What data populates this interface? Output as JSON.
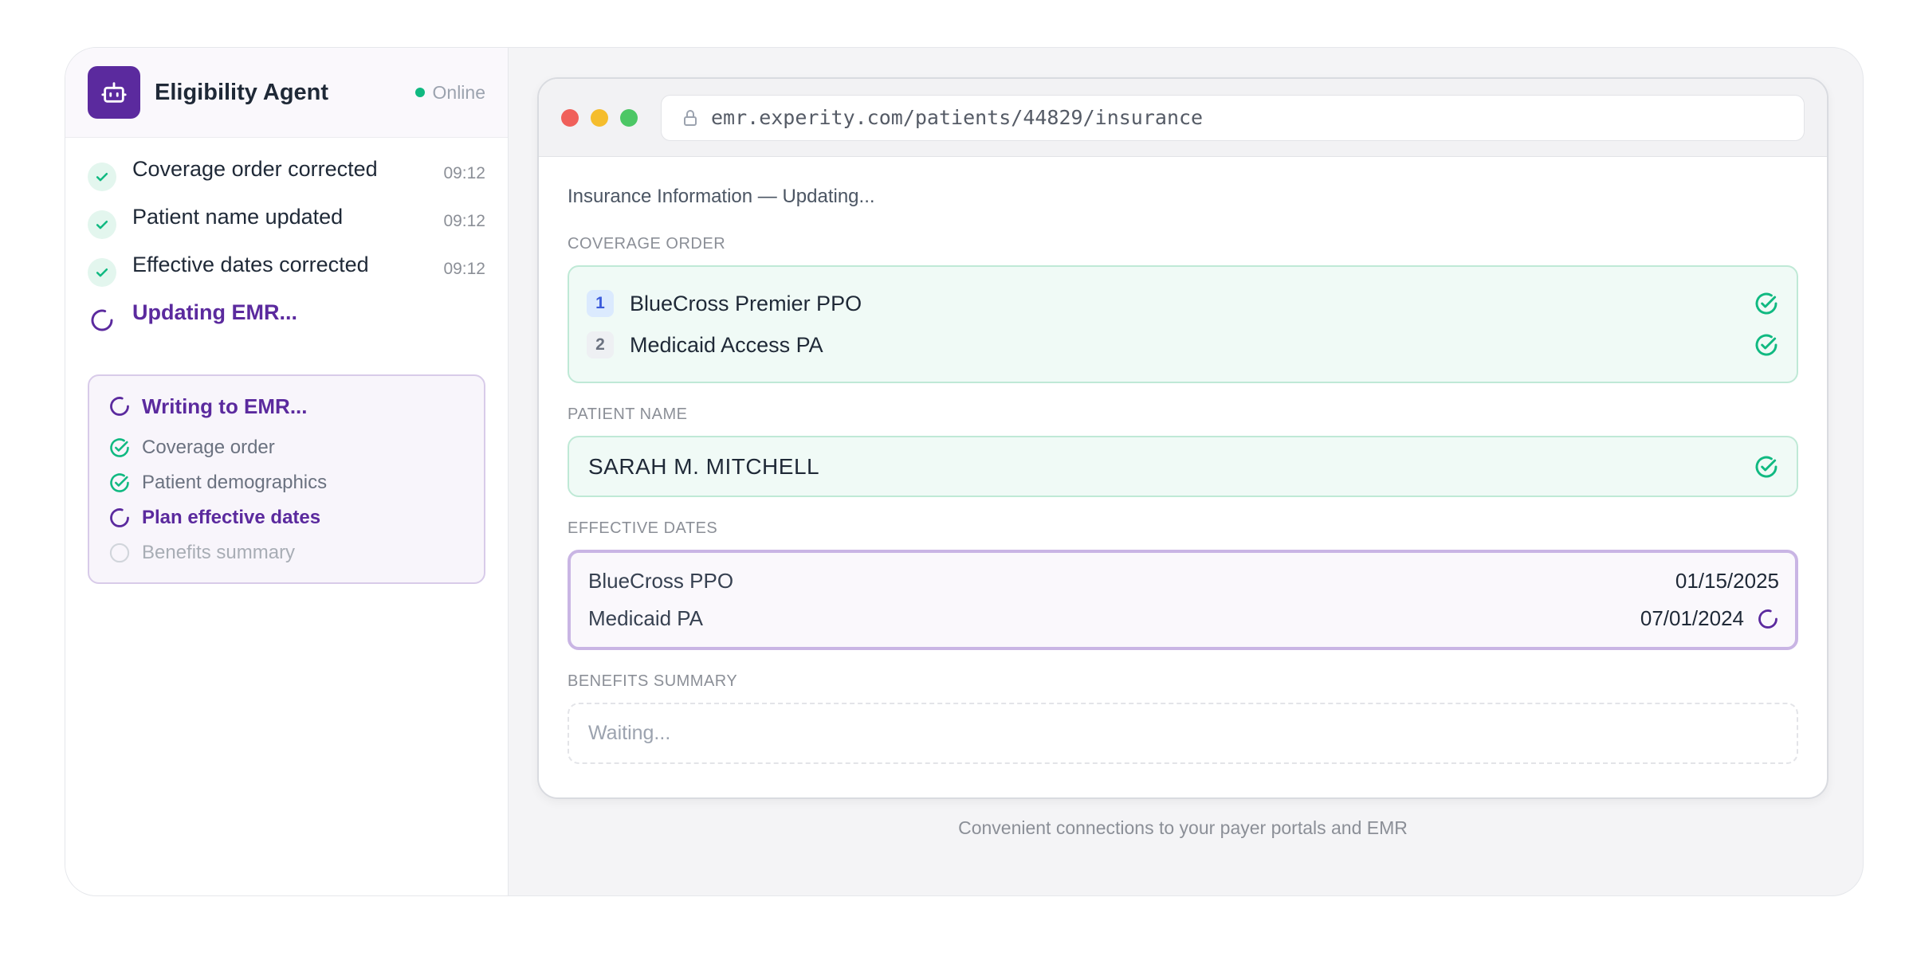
{
  "agent": {
    "title": "Eligibility Agent",
    "status": "Online",
    "status_color": "#10b981",
    "accent_color": "#5b2a9e",
    "steps": [
      {
        "label": "Coverage order corrected",
        "time": "09:12",
        "state": "done"
      },
      {
        "label": "Patient name updated",
        "time": "09:12",
        "state": "done"
      },
      {
        "label": "Effective dates corrected",
        "time": "09:12",
        "state": "done"
      },
      {
        "label": "Updating EMR...",
        "time": "",
        "state": "in-progress"
      }
    ],
    "emr_card": {
      "title": "Writing to EMR...",
      "items": [
        {
          "label": "Coverage order",
          "state": "done"
        },
        {
          "label": "Patient demographics",
          "state": "done"
        },
        {
          "label": "Plan effective dates",
          "state": "in-progress"
        },
        {
          "label": "Benefits summary",
          "state": "pending"
        }
      ]
    }
  },
  "browser": {
    "url": "emr.experity.com/patients/44829/insurance",
    "window_dots": [
      "#f0605a",
      "#f5bd2d",
      "#4cc765"
    ],
    "page_title": "Insurance Information — Updating...",
    "coverage_order": {
      "label": "COVERAGE ORDER",
      "items": [
        {
          "rank": "1",
          "name": "BlueCross Premier PPO",
          "verified": true
        },
        {
          "rank": "2",
          "name": "Medicaid Access PA",
          "verified": true
        }
      ]
    },
    "patient_name": {
      "label": "PATIENT NAME",
      "value": "SARAH M. MITCHELL",
      "verified": true
    },
    "effective_dates": {
      "label": "EFFECTIVE DATES",
      "rows": [
        {
          "plan": "BlueCross PPO",
          "date": "01/15/2025",
          "state": "done"
        },
        {
          "plan": "Medicaid PA",
          "date": "07/01/2024",
          "state": "in-progress"
        }
      ]
    },
    "benefits_summary": {
      "label": "BENEFITS SUMMARY",
      "value": "Waiting..."
    }
  },
  "footer": "Convenient connections to your payer portals and EMR"
}
